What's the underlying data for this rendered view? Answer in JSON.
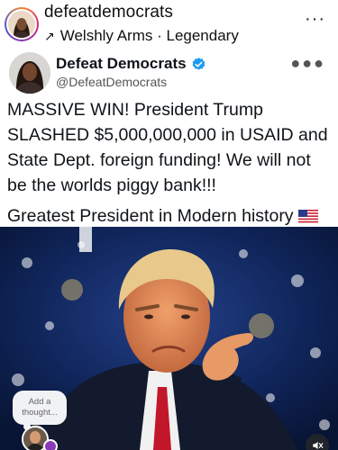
{
  "post": {
    "username": "defeatdemocrats",
    "music_label": "Welshly Arms · Legendary",
    "music_icon": "arrow-up-right-icon",
    "more_icon": "more-horizontal-icon"
  },
  "tweet": {
    "display_name": "Defeat Democrats",
    "handle": "@DefeatDemocrats",
    "verified": true,
    "verified_color": "#1d9bf0",
    "text": "MASSIVE WIN! President Trump SLASHED $5,000,000,000 in USAID and State Dept. foreign funding! We will not be the worlds piggy bank!!!",
    "text_line2": "Greatest President in Modern history",
    "flag_emoji_icon": "us-flag-icon"
  },
  "overlay": {
    "thought_placeholder": "Add a thought...",
    "mute_icon": "speaker-muted-icon"
  }
}
